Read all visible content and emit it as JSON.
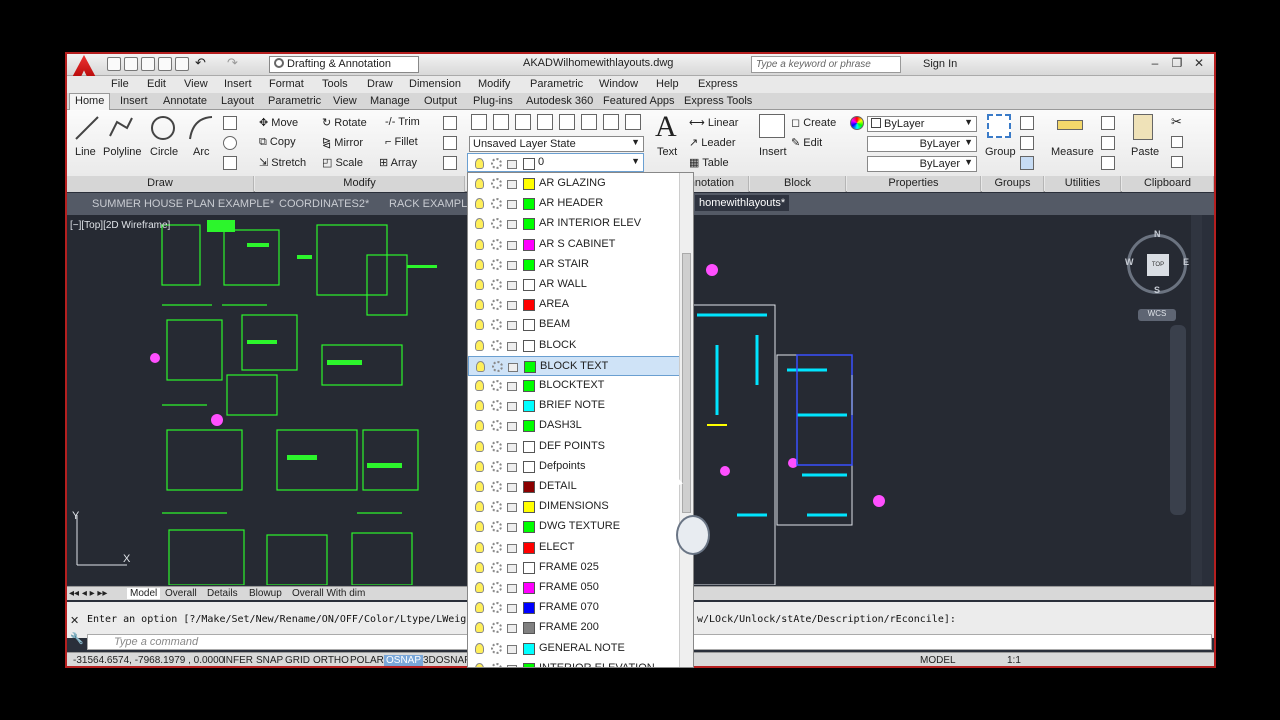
{
  "titlebar": {
    "workspace": "Drafting & Annotation",
    "filename": "AKADWilhomewithlayouts.dwg",
    "search_placeholder": "Type a keyword or phrase",
    "signin": "Sign In"
  },
  "menubar": [
    "File",
    "Edit",
    "View",
    "Insert",
    "Format",
    "Tools",
    "Draw",
    "Dimension",
    "Modify",
    "Parametric",
    "Window",
    "Help",
    "Express"
  ],
  "ribbon_tabs": [
    "Home",
    "Insert",
    "Annotate",
    "Layout",
    "Parametric",
    "View",
    "Manage",
    "Output",
    "Plug-ins",
    "Autodesk 360",
    "Featured Apps",
    "Express Tools"
  ],
  "ribbon": {
    "draw": {
      "line": "Line",
      "polyline": "Polyline",
      "circle": "Circle",
      "arc": "Arc",
      "title": "Draw"
    },
    "modify": {
      "move": "Move",
      "rotate": "Rotate",
      "trim": "Trim",
      "copy": "Copy",
      "mirror": "Mirror",
      "fillet": "Fillet",
      "stretch": "Stretch",
      "scale": "Scale",
      "array": "Array",
      "title": "Modify"
    },
    "layers": {
      "state": "Unsaved Layer State",
      "current": "0"
    },
    "annotation": {
      "text": "Text",
      "linear": "Linear",
      "leader": "Leader",
      "table": "Table",
      "title": "Annotation"
    },
    "block": {
      "insert": "Insert",
      "create": "Create",
      "edit": "Edit",
      "title": "Block"
    },
    "properties": {
      "color": "ByLayer",
      "lineweight": "ByLayer",
      "linetype": "ByLayer",
      "title": "Properties"
    },
    "groups": {
      "group": "Group",
      "title": "Groups"
    },
    "utilities": {
      "measure": "Measure",
      "title": "Utilities"
    },
    "clipboard": {
      "paste": "Paste",
      "title": "Clipboard"
    }
  },
  "doc_tabs": [
    "SUMMER HOUSE PLAN EXAMPLE*",
    "COORDINATES2*",
    "RACK EXAMPLE*",
    "homewithlayouts*"
  ],
  "viewport_label": "[−][Top][2D Wireframe]",
  "navcube": {
    "n": "N",
    "s": "S",
    "e": "E",
    "w": "W",
    "top": "TOP",
    "wcs": "WCS"
  },
  "layers": [
    {
      "name": "AR GLAZING",
      "color": "#ffff00"
    },
    {
      "name": "AR HEADER",
      "color": "#00ff00"
    },
    {
      "name": "AR INTERIOR ELEV",
      "color": "#00ff00"
    },
    {
      "name": "AR S CABINET",
      "color": "#ff00ff"
    },
    {
      "name": "AR STAIR",
      "color": "#00ff00"
    },
    {
      "name": "AR WALL",
      "color": "#ffffff"
    },
    {
      "name": "AREA",
      "color": "#ff0000"
    },
    {
      "name": "BEAM",
      "color": "#ffffff"
    },
    {
      "name": "BLOCK",
      "color": "#ffffff"
    },
    {
      "name": "BLOCK TEXT",
      "color": "#00ff00"
    },
    {
      "name": "BLOCKTEXT",
      "color": "#00ff00"
    },
    {
      "name": "BRIEF NOTE",
      "color": "#00ffff"
    },
    {
      "name": "DASH3L",
      "color": "#00ff00"
    },
    {
      "name": "DEF POINTS",
      "color": "#ffffff"
    },
    {
      "name": "Defpoints",
      "color": "#ffffff"
    },
    {
      "name": "DETAIL",
      "color": "#8b0000"
    },
    {
      "name": "DIMENSIONS",
      "color": "#ffff00"
    },
    {
      "name": "DWG TEXTURE",
      "color": "#00ff00"
    },
    {
      "name": "ELECT",
      "color": "#ff0000"
    },
    {
      "name": "FRAME 025",
      "color": "#ffffff"
    },
    {
      "name": "FRAME 050",
      "color": "#ff00ff"
    },
    {
      "name": "FRAME 070",
      "color": "#0000ff"
    },
    {
      "name": "FRAME 200",
      "color": "#808080"
    },
    {
      "name": "GENERAL NOTE",
      "color": "#00ffff"
    },
    {
      "name": "INTERIOR ELEVATION",
      "color": "#00ff00"
    }
  ],
  "selected_layer": "BLOCK TEXT",
  "layout_tabs": [
    "Model",
    "Overall",
    "Details",
    "Blowup",
    "Overall With dim"
  ],
  "command": {
    "history_line": "Enter an option [?/Make/Set/New/Rename/ON/OFF/Color/Ltype/LWeight",
    "history_tail": "w/LOck/Unlock/stAte/Description/rEconcile]:",
    "placeholder": "Type a command"
  },
  "status": {
    "coords": "-31564.6574, -7968.1979 , 0.0000",
    "toggles": [
      "INFER",
      "SNAP",
      "GRID",
      "ORTHO",
      "POLAR",
      "OSNAP",
      "3DOSNAP"
    ],
    "model": "MODEL",
    "scale": "1:1"
  }
}
